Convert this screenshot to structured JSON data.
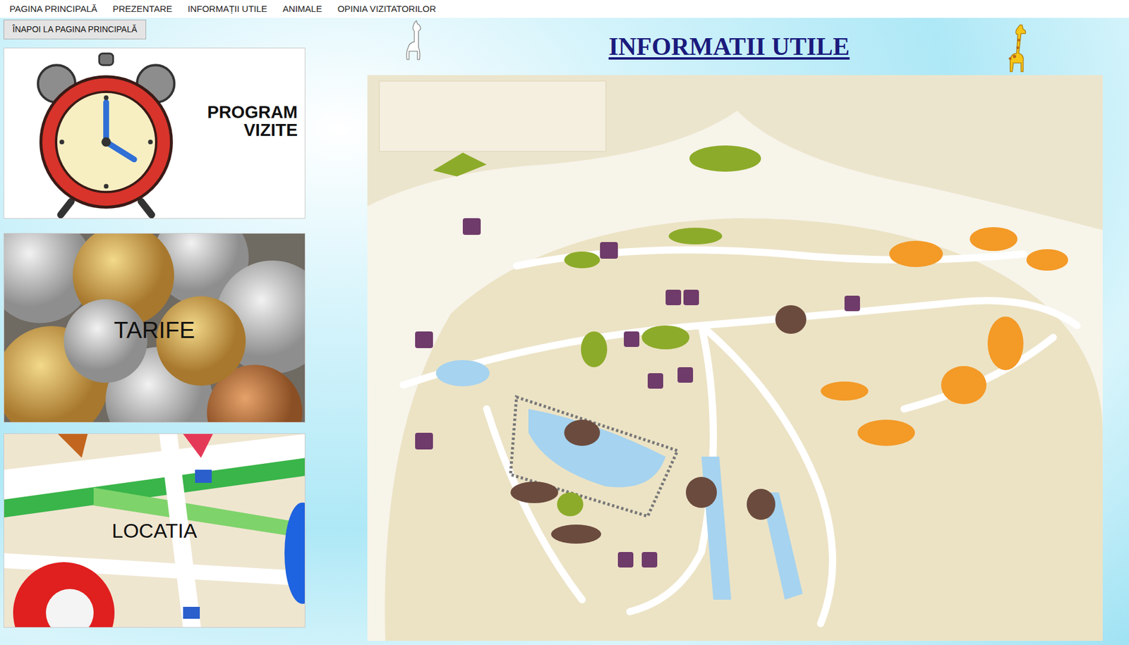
{
  "nav": {
    "items": [
      {
        "label": "PAGINA PRINCIPALĂ"
      },
      {
        "label": "PREZENTARE"
      },
      {
        "label": "INFORMAȚII UTILE"
      },
      {
        "label": "ANIMALE"
      },
      {
        "label": "OPINIA VIZITATORILOR"
      }
    ]
  },
  "back_button": {
    "label": "ÎNAPOI LA PAGINA PRINCIPALĂ"
  },
  "page_title": "INFORMATII UTILE",
  "cards": [
    {
      "label": "PROGRAM VIZITE",
      "kind": "clock"
    },
    {
      "label": "TARIFE",
      "kind": "coins"
    },
    {
      "label": "LOCATIA",
      "kind": "map"
    }
  ]
}
